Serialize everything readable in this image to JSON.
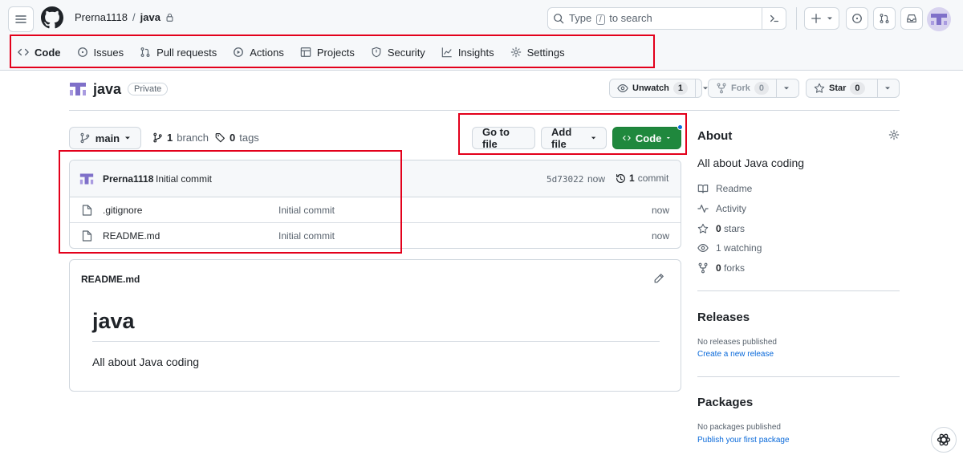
{
  "header": {
    "owner": "Prerna1118",
    "separator": "/",
    "repo": "java",
    "search": {
      "prefix": "Type",
      "key": "/",
      "suffix": "to search"
    }
  },
  "nav": {
    "items": [
      {
        "label": "Code",
        "icon": "code-icon",
        "active": true
      },
      {
        "label": "Issues",
        "icon": "issue-icon"
      },
      {
        "label": "Pull requests",
        "icon": "pull-request-icon"
      },
      {
        "label": "Actions",
        "icon": "play-icon"
      },
      {
        "label": "Projects",
        "icon": "table-icon"
      },
      {
        "label": "Security",
        "icon": "shield-icon"
      },
      {
        "label": "Insights",
        "icon": "graph-icon"
      },
      {
        "label": "Settings",
        "icon": "gear-icon"
      }
    ]
  },
  "repo_header": {
    "name": "java",
    "visibility": "Private",
    "unwatch_label": "Unwatch",
    "unwatch_count": "1",
    "fork_label": "Fork",
    "fork_count": "0",
    "star_label": "Star",
    "star_count": "0"
  },
  "toolbar": {
    "branch": "main",
    "branch_count": "1",
    "branch_label": "branch",
    "tag_count": "0",
    "tag_label": "tags",
    "goto_file": "Go to file",
    "add_file": "Add file",
    "code": "Code"
  },
  "commit": {
    "author": "Prerna1118",
    "message": "Initial commit",
    "sha": "5d73022",
    "time": "now",
    "commit_count": "1",
    "commit_label": "commit"
  },
  "files": [
    {
      "name": ".gitignore",
      "message": "Initial commit",
      "time": "now"
    },
    {
      "name": "README.md",
      "message": "Initial commit",
      "time": "now"
    }
  ],
  "readme": {
    "filename": "README.md",
    "heading": "java",
    "body": "All about Java coding"
  },
  "sidebar": {
    "about_title": "About",
    "description": "All about Java coding",
    "readme": "Readme",
    "activity": "Activity",
    "stars_count": "0",
    "stars_label": "stars",
    "watching_count": "1",
    "watching_label": "watching",
    "forks_count": "0",
    "forks_label": "forks",
    "releases_title": "Releases",
    "no_releases": "No releases published",
    "create_release": "Create a new release",
    "packages_title": "Packages",
    "no_packages": "No packages published",
    "publish_package": "Publish your first package"
  },
  "colors": {
    "accent_green": "#1f883d",
    "link_blue": "#0969da",
    "highlight_red": "#e3001b",
    "nav_underline": "#fd8c73"
  }
}
